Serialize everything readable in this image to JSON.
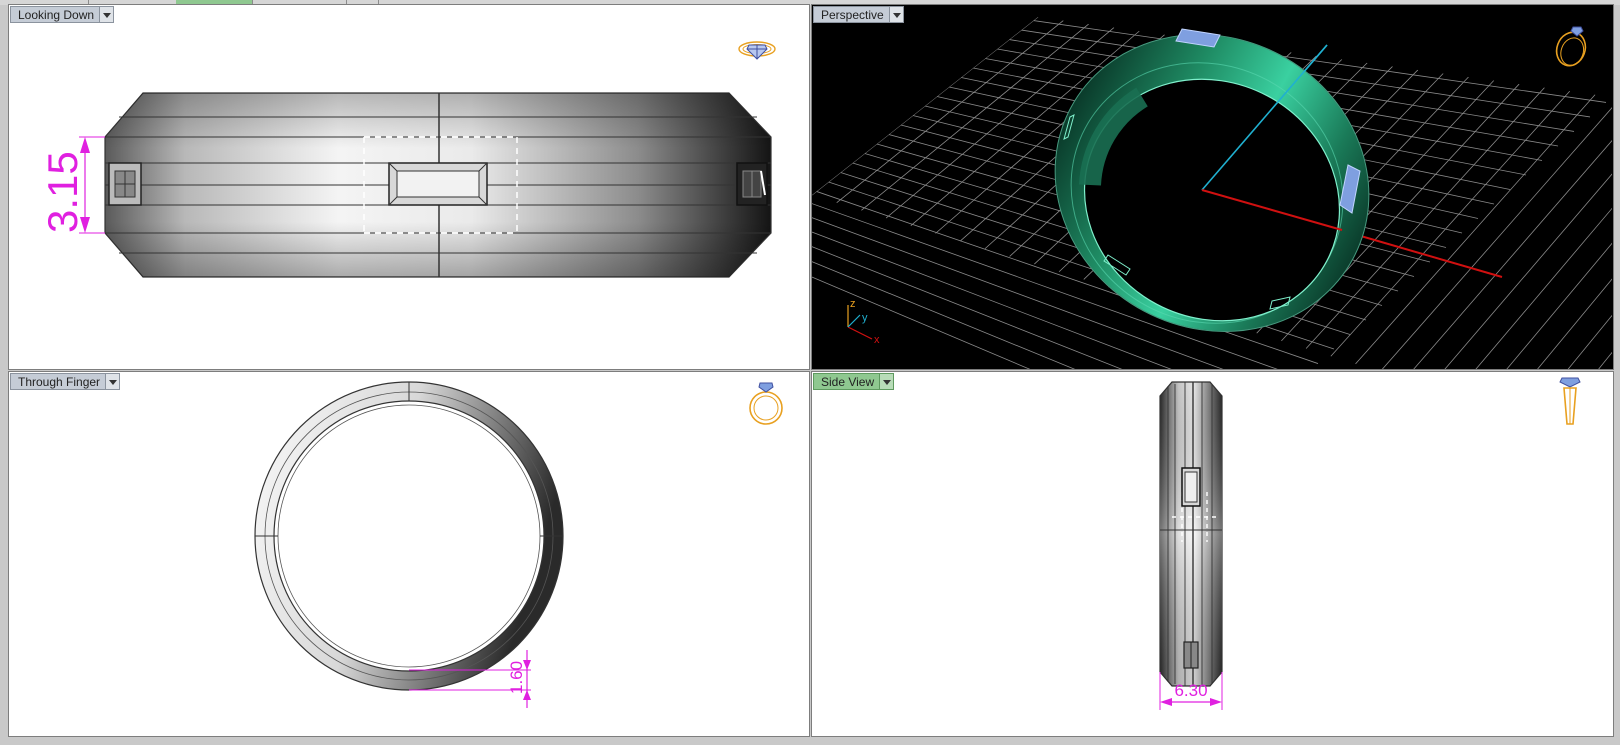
{
  "viewports": [
    {
      "id": "looking-down",
      "label": "Looking Down",
      "background": "#ffffff",
      "dimension": "3.15",
      "icon": "top-view-ring-icon"
    },
    {
      "id": "perspective",
      "label": "Perspective",
      "background": "#000000",
      "icon": "perspective-ring-icon",
      "axes": {
        "z": "z",
        "y": "y",
        "x": "x"
      }
    },
    {
      "id": "through-finger",
      "label": "Through Finger",
      "background": "#ffffff",
      "dimension": "1.60",
      "icon": "front-view-ring-icon"
    },
    {
      "id": "side-view",
      "label": "Side View",
      "background": "#ffffff",
      "dimension": "6.30",
      "icon": "side-view-ring-icon",
      "active": true
    }
  ],
  "colors": {
    "dimension": "#e020e0",
    "ring_green": "#1f8c64",
    "gem_blue": "#7f9fe0",
    "icon_gold": "#e8a020",
    "axis_red": "#d01010",
    "axis_cyan": "#20b0d0"
  }
}
